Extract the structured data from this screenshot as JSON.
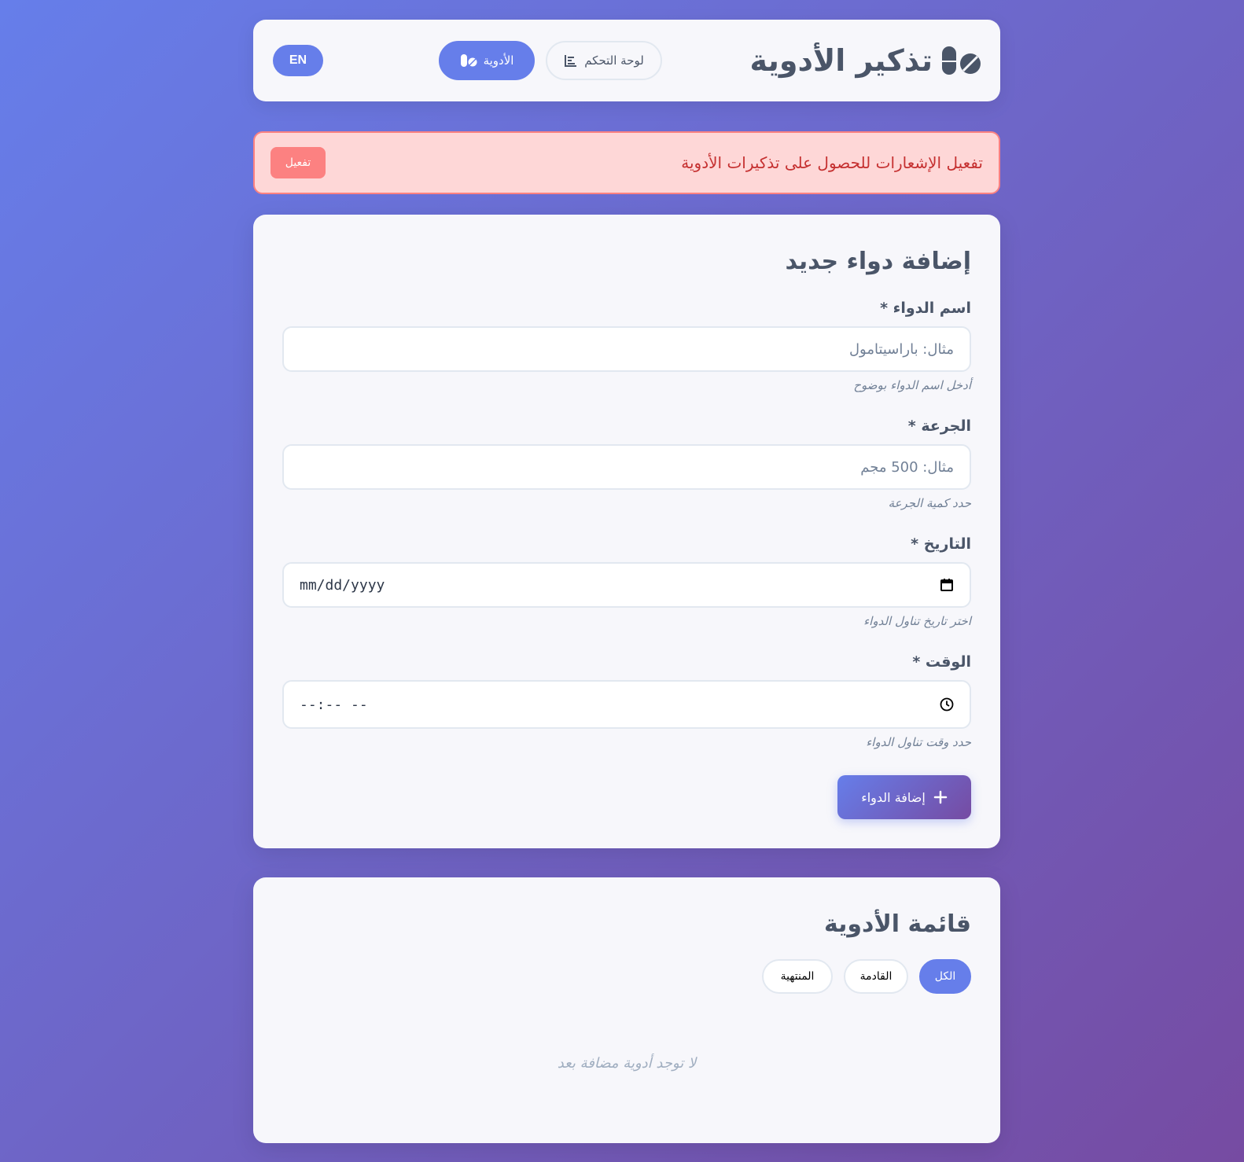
{
  "header": {
    "app_title": "تذكير الأدوية",
    "app_icon": "pills-icon",
    "nav": [
      {
        "label": "الأدوية",
        "icon": "pills-icon",
        "active": true
      },
      {
        "label": "لوحة التحكم",
        "icon": "chart-icon",
        "active": false
      }
    ],
    "lang_button": "EN"
  },
  "banner": {
    "text": "تفعيل الإشعارات للحصول على تذكيرات الأدوية",
    "button": "تفعيل"
  },
  "form": {
    "title": "إضافة دواء جديد",
    "fields": [
      {
        "label": "اسم الدواء *",
        "placeholder": "مثال: باراسيتامول",
        "hint": "أدخل اسم الدواء بوضوح"
      },
      {
        "label": "الجرعة *",
        "placeholder": "مثال: 500 مجم",
        "hint": "حدد كمية الجرعة"
      },
      {
        "label": "التاريخ *",
        "value": "mm/dd/yyyy",
        "icon": "calendar-icon",
        "hint": "اختر تاريخ تناول الدواء"
      },
      {
        "label": "الوقت *",
        "value": "--:-- --",
        "icon": "clock-icon",
        "hint": "حدد وقت تناول الدواء"
      }
    ],
    "submit": "إضافة الدواء",
    "submit_icon": "plus-icon"
  },
  "list": {
    "title": "قائمة الأدوية",
    "filters": [
      {
        "label": "الكل",
        "active": true
      },
      {
        "label": "القادمة",
        "active": false
      },
      {
        "label": "المنتهية",
        "active": false
      }
    ],
    "empty_message": "لا توجد أدوية مضافة بعد"
  },
  "colors": {
    "accent": "#667eea",
    "accent_end": "#764ba2",
    "banner_bg": "#fed7d7",
    "banner_text": "#c53030",
    "banner_button": "#fc8181"
  }
}
